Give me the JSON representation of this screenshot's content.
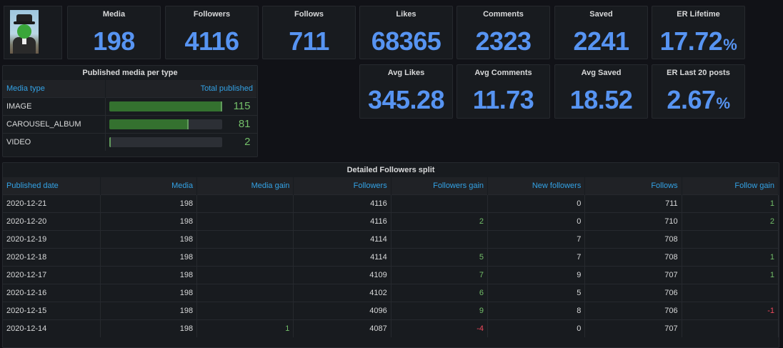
{
  "stats_top": [
    {
      "title": "Media",
      "value": "198",
      "unit": ""
    },
    {
      "title": "Followers",
      "value": "4116",
      "unit": ""
    },
    {
      "title": "Follows",
      "value": "711",
      "unit": ""
    },
    {
      "title": "Likes",
      "value": "68365",
      "unit": ""
    },
    {
      "title": "Comments",
      "value": "2323",
      "unit": ""
    },
    {
      "title": "Saved",
      "value": "2241",
      "unit": ""
    },
    {
      "title": "ER Lifetime",
      "value": "17.72",
      "unit": "%"
    }
  ],
  "stats_bottom": [
    {
      "title": "Avg Likes",
      "value": "345.28",
      "unit": ""
    },
    {
      "title": "Avg Comments",
      "value": "11.73",
      "unit": ""
    },
    {
      "title": "Avg Saved",
      "value": "18.52",
      "unit": ""
    },
    {
      "title": "ER Last 20 posts",
      "value": "2.67",
      "unit": "%"
    }
  ],
  "media_type_panel": {
    "title": "Published media per type",
    "col_type": "Media type",
    "col_total": "Total published",
    "max": 115,
    "rows": [
      {
        "type": "IMAGE",
        "total": 115
      },
      {
        "type": "CAROUSEL_ALBUM",
        "total": 81
      },
      {
        "type": "VIDEO",
        "total": 2
      }
    ]
  },
  "followers_table": {
    "title": "Detailed Followers split",
    "columns": [
      "Published date",
      "Media",
      "Media gain",
      "Followers",
      "Followers gain",
      "New followers",
      "Follows",
      "Follow gain"
    ],
    "rows": [
      [
        "2020-12-21",
        "198",
        "",
        "4116",
        "",
        "0",
        "711",
        "1"
      ],
      [
        "2020-12-20",
        "198",
        "",
        "4116",
        "2",
        "0",
        "710",
        "2"
      ],
      [
        "2020-12-19",
        "198",
        "",
        "4114",
        "",
        "7",
        "708",
        ""
      ],
      [
        "2020-12-18",
        "198",
        "",
        "4114",
        "5",
        "7",
        "708",
        "1"
      ],
      [
        "2020-12-17",
        "198",
        "",
        "4109",
        "7",
        "9",
        "707",
        "1"
      ],
      [
        "2020-12-16",
        "198",
        "",
        "4102",
        "6",
        "5",
        "706",
        ""
      ],
      [
        "2020-12-15",
        "198",
        "",
        "4096",
        "9",
        "8",
        "706",
        "-1"
      ],
      [
        "2020-12-14",
        "198",
        "1",
        "4087",
        "-4",
        "0",
        "707",
        ""
      ]
    ]
  },
  "colors": {
    "accent_blue": "#5794f2",
    "positive": "#73bf69",
    "negative": "#f2495c",
    "header_blue": "#33a2e5"
  }
}
